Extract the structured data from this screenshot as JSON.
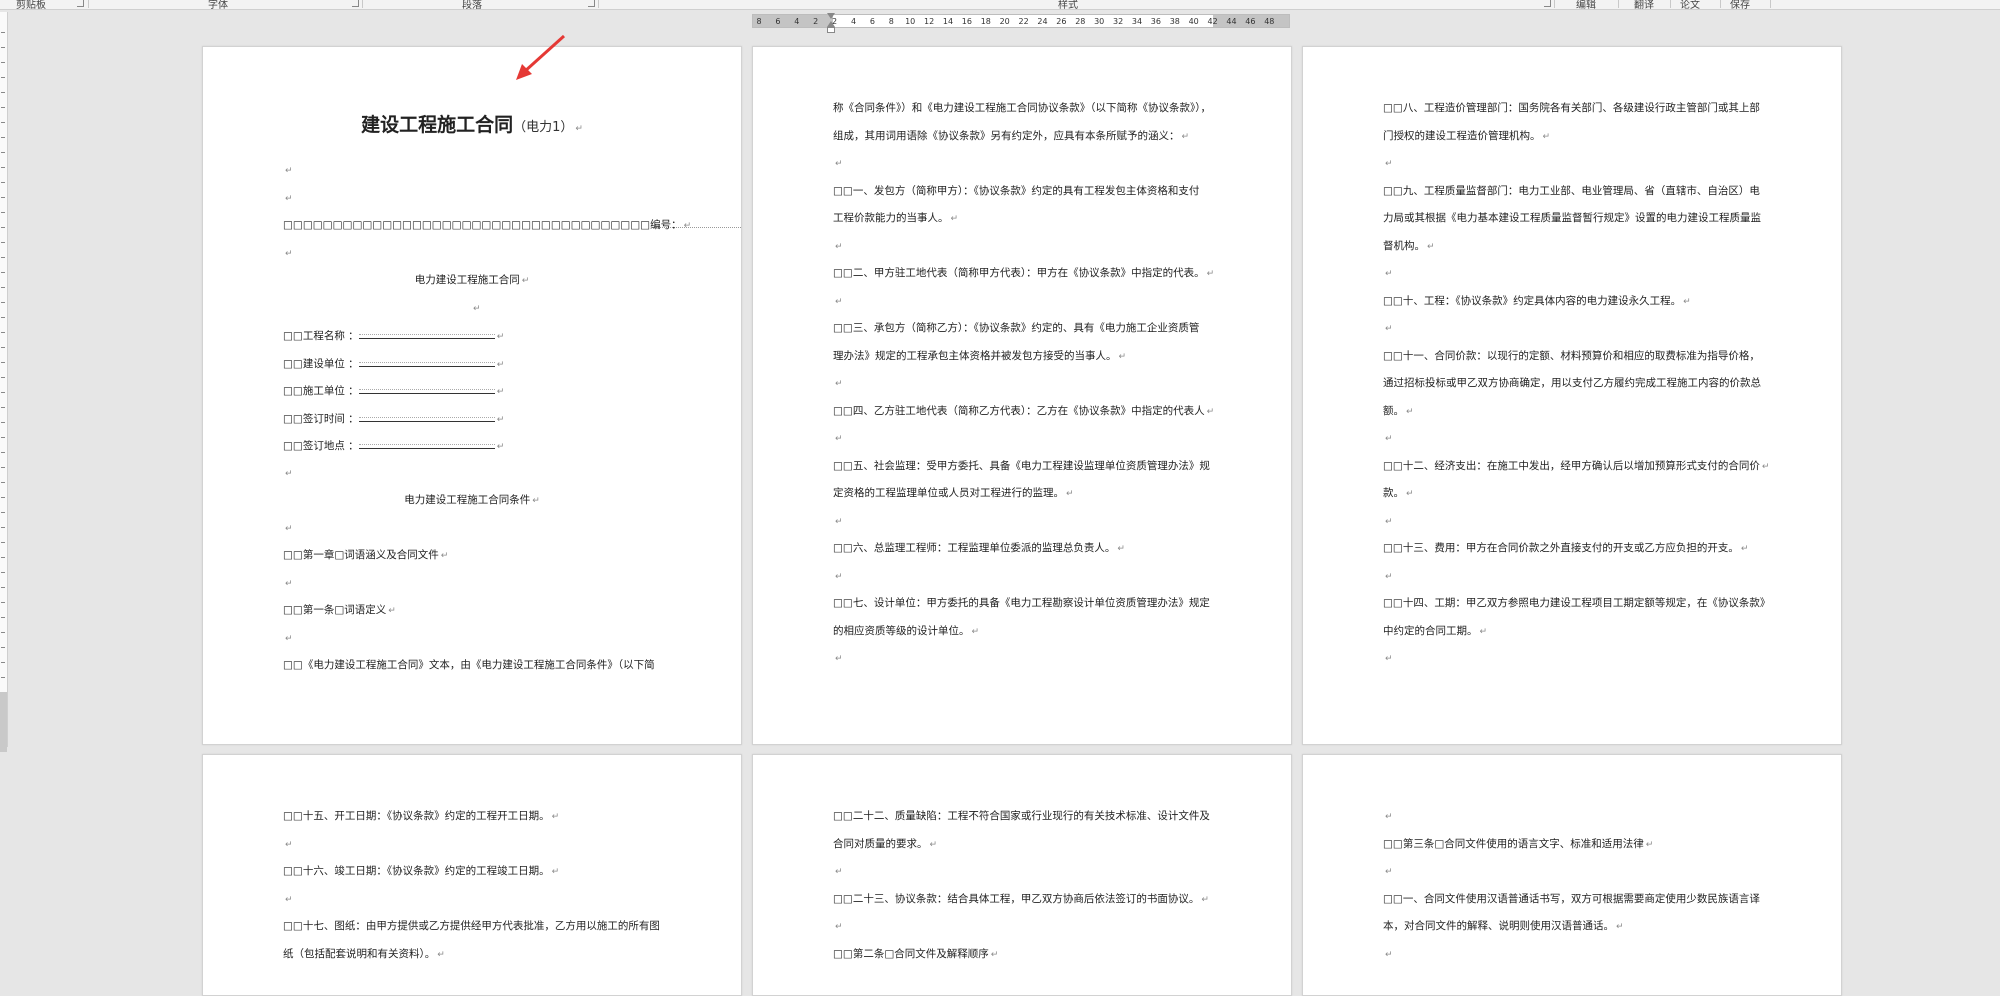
{
  "ribbon": {
    "groups": [
      "剪贴板",
      "字体",
      "段落",
      "样式",
      "编辑",
      "翻译",
      "论文",
      "保存"
    ]
  },
  "ruler": {
    "numbers": [
      "8",
      "6",
      "4",
      "2",
      "2",
      "4",
      "6",
      "8",
      "10",
      "12",
      "14",
      "16",
      "18",
      "20",
      "22",
      "24",
      "26",
      "28",
      "30",
      "32",
      "34",
      "36",
      "38",
      "40",
      "42",
      "44",
      "46",
      "48"
    ]
  },
  "colors": {
    "arrow": "#e53935",
    "background": "#e6e6e6",
    "page": "#ffffff"
  },
  "pages": [
    {
      "lines": [
        {
          "type": "title",
          "text": "建设工程施工合同",
          "sub": "（电力1）"
        },
        {
          "type": "empty"
        },
        {
          "type": "empty"
        },
        {
          "type": "number",
          "text": "□□□□□□□□□□□□□□□□□□□□□□□□□□□□□□□□□□□□□编号："
        },
        {
          "type": "empty"
        },
        {
          "type": "center",
          "text": "电力建设工程施工合同"
        },
        {
          "type": "empty-center"
        },
        {
          "type": "field",
          "text": "□□工程名称 ："
        },
        {
          "type": "field",
          "text": "□□建设单位 ："
        },
        {
          "type": "field",
          "text": "□□施工单位 ："
        },
        {
          "type": "field",
          "text": "□□签订时间 ："
        },
        {
          "type": "field",
          "text": "□□签订地点 ："
        },
        {
          "type": "empty"
        },
        {
          "type": "center",
          "text": "电力建设工程施工合同条件"
        },
        {
          "type": "empty"
        },
        {
          "type": "text",
          "text": "□□第一章□词语涵义及合同文件"
        },
        {
          "type": "empty"
        },
        {
          "type": "text",
          "text": "□□第一条□词语定义"
        },
        {
          "type": "empty"
        },
        {
          "type": "text",
          "text": "□□《电力建设工程施工合同》文本，由《电力建设工程施工合同条件》（以下简",
          "noret": true
        }
      ]
    },
    {
      "lines": [
        {
          "type": "text",
          "text": "称《合同条件》）和《电力建设工程施工合同协议条款》（以下简称《协议条款》），",
          "noret": true
        },
        {
          "type": "text",
          "text": "组成，其用词用语除《协议条款》另有约定外，应具有本条所赋予的涵义："
        },
        {
          "type": "empty"
        },
        {
          "type": "text",
          "text": "□□一、发包方（简称甲方）：《协议条款》约定的具有工程发包主体资格和支付",
          "noret": true
        },
        {
          "type": "text",
          "text": "工程价款能力的当事人。"
        },
        {
          "type": "empty"
        },
        {
          "type": "text",
          "text": "□□二、甲方驻工地代表（简称甲方代表）：甲方在《协议条款》中指定的代表。"
        },
        {
          "type": "empty"
        },
        {
          "type": "text",
          "text": "□□三、承包方（简称乙方）：《协议条款》约定的、具有《电力施工企业资质管",
          "noret": true
        },
        {
          "type": "text",
          "text": "理办法》规定的工程承包主体资格并被发包方接受的当事人。"
        },
        {
          "type": "empty"
        },
        {
          "type": "text",
          "text": "□□四、乙方驻工地代表（简称乙方代表）：乙方在《协议条款》中指定的代表人"
        },
        {
          "type": "empty"
        },
        {
          "type": "text",
          "text": "□□五、社会监理：受甲方委托、具备《电力工程建设监理单位资质管理办法》规",
          "noret": true
        },
        {
          "type": "text",
          "text": "定资格的工程监理单位或人员对工程进行的监理。"
        },
        {
          "type": "empty"
        },
        {
          "type": "text",
          "text": "□□六、总监理工程师：工程监理单位委派的监理总负责人。"
        },
        {
          "type": "empty"
        },
        {
          "type": "text",
          "text": "□□七、设计单位：甲方委托的具备《电力工程勘察设计单位资质管理办法》规定",
          "noret": true
        },
        {
          "type": "text",
          "text": "的相应资质等级的设计单位。"
        },
        {
          "type": "empty"
        }
      ]
    },
    {
      "lines": [
        {
          "type": "text",
          "text": "□□八、工程造价管理部门：国务院各有关部门、各级建设行政主管部门或其上部",
          "noret": true
        },
        {
          "type": "text",
          "text": "门授权的建设工程造价管理机构。"
        },
        {
          "type": "empty"
        },
        {
          "type": "text",
          "text": "□□九、工程质量监督部门：电力工业部、电业管理局、省（直辖市、自治区）电",
          "noret": true
        },
        {
          "type": "text",
          "text": "力局或其根据《电力基本建设工程质量监督暂行规定》设置的电力建设工程质量监",
          "noret": true
        },
        {
          "type": "text",
          "text": "督机构。"
        },
        {
          "type": "empty"
        },
        {
          "type": "text",
          "text": "□□十、工程：《协议条款》约定具体内容的电力建设永久工程。"
        },
        {
          "type": "empty"
        },
        {
          "type": "text",
          "text": "□□十一、合同价款：以现行的定额、材料预算价和相应的取费标准为指导价格，",
          "noret": true
        },
        {
          "type": "text",
          "text": "通过招标投标或甲乙双方协商确定，用以支付乙方履约完成工程施工内容的价款总",
          "noret": true
        },
        {
          "type": "text",
          "text": "额。"
        },
        {
          "type": "empty"
        },
        {
          "type": "text",
          "text": "□□十二、经济支出：在施工中发出，经甲方确认后以增加预算形式支付的合同价"
        },
        {
          "type": "text",
          "text": "款。"
        },
        {
          "type": "empty"
        },
        {
          "type": "text",
          "text": "□□十三、费用：甲方在合同价款之外直接支付的开支或乙方应负担的开支。"
        },
        {
          "type": "empty"
        },
        {
          "type": "text",
          "text": "□□十四、工期：甲乙双方参照电力建设工程项目工期定额等规定，在《协议条款》",
          "noret": true
        },
        {
          "type": "text",
          "text": "中约定的合同工期。"
        },
        {
          "type": "empty"
        }
      ]
    },
    {
      "lines": [
        {
          "type": "text",
          "text": "□□十五、开工日期：《协议条款》约定的工程开工日期。"
        },
        {
          "type": "empty"
        },
        {
          "type": "text",
          "text": "□□十六、竣工日期：《协议条款》约定的工程竣工日期。"
        },
        {
          "type": "empty"
        },
        {
          "type": "text",
          "text": "□□十七、图纸：由甲方提供或乙方提供经甲方代表批准，乙方用以施工的所有图",
          "noret": true
        },
        {
          "type": "text",
          "text": "纸（包括配套说明和有关资料）。"
        }
      ]
    },
    {
      "lines": [
        {
          "type": "text",
          "text": "□□二十二、质量缺陷：工程不符合国家或行业现行的有关技术标准、设计文件及",
          "noret": true
        },
        {
          "type": "text",
          "text": "合同对质量的要求。"
        },
        {
          "type": "empty"
        },
        {
          "type": "text",
          "text": "□□二十三、协议条款：结合具体工程，甲乙双方协商后依法签订的书面协议。"
        },
        {
          "type": "empty"
        },
        {
          "type": "text",
          "text": "□□第二条□合同文件及解释顺序"
        }
      ]
    },
    {
      "lines": [
        {
          "type": "empty"
        },
        {
          "type": "text",
          "text": "□□第三条□合同文件使用的语言文字、标准和适用法律"
        },
        {
          "type": "empty"
        },
        {
          "type": "text",
          "text": "□□一、合同文件使用汉语普通话书写，双方可根据需要商定使用少数民族语言译",
          "noret": true
        },
        {
          "type": "text",
          "text": "本，对合同文件的解释、说明则使用汉语普通话。"
        },
        {
          "type": "empty"
        }
      ]
    }
  ]
}
